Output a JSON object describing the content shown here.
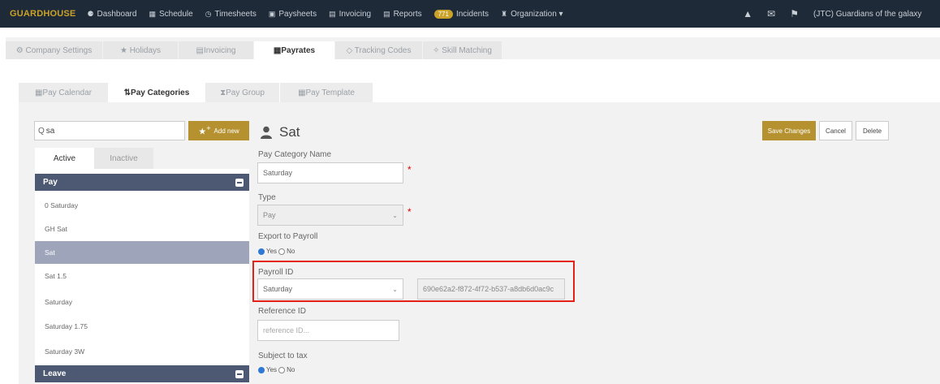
{
  "nav": {
    "brand": "GUARDHOUSE",
    "items": [
      {
        "icon": "dashboard-icon",
        "glyph": "⚈",
        "label": "Dashboard"
      },
      {
        "icon": "calendar-icon",
        "glyph": "▦",
        "label": "Schedule"
      },
      {
        "icon": "clock-icon",
        "glyph": "◷",
        "label": "Timesheets"
      },
      {
        "icon": "money-icon",
        "glyph": "▣",
        "label": "Paysheets"
      },
      {
        "icon": "invoice-icon",
        "glyph": "▤",
        "label": "Invoicing"
      },
      {
        "icon": "report-icon",
        "glyph": "▤",
        "label": "Reports"
      }
    ],
    "incidents_badge": "771",
    "incidents_label": "Incidents",
    "organization_label": "Organization ▾",
    "user": "(JTC) Guardians of the galaxy"
  },
  "settings_tabs": [
    "⚙ Company Settings",
    "★ Holidays",
    "▤Invoicing",
    "▦Payrates",
    "◇ Tracking Codes",
    "✧ Skill Matching"
  ],
  "payrate_tabs": [
    "▦Pay Calendar",
    "⇅Pay Categories",
    "⧗Pay Group",
    "▦Pay Template"
  ],
  "left": {
    "search_value": "sa",
    "add_new_label": "Add new",
    "active_label": "Active",
    "inactive_label": "Inactive",
    "group_pay": "Pay",
    "items": [
      "0 Saturday",
      "GH Sat",
      "Sat",
      "Sat 1.5",
      "Saturday",
      "Saturday 1.75",
      "Saturday 3W"
    ],
    "group_leave": "Leave"
  },
  "form": {
    "title": "Sat",
    "name_label": "Pay Category Name",
    "name_value": "Saturday",
    "type_label": "Type",
    "type_value": "Pay",
    "export_label": "Export to Payroll",
    "payroll_id_label": "Payroll ID",
    "payroll_id_value": "Saturday",
    "payroll_guid": "690e62a2-f872-4f72-b537-a8db6d0ac9c",
    "reference_label": "Reference ID",
    "reference_placeholder": "reference ID...",
    "tax_label": "Subject to tax",
    "yes": "Yes",
    "no": "No",
    "required_mark": "*"
  },
  "actions": {
    "save": "Save Changes",
    "cancel": "Cancel",
    "delete": "Delete"
  },
  "colors": {
    "nav_bg": "#1f2a38",
    "brand_gold": "#c9a227",
    "button_gold": "#b5922f",
    "group_header": "#4d5872",
    "selected_row": "#9ea5bb",
    "highlight_red": "#e32118"
  }
}
